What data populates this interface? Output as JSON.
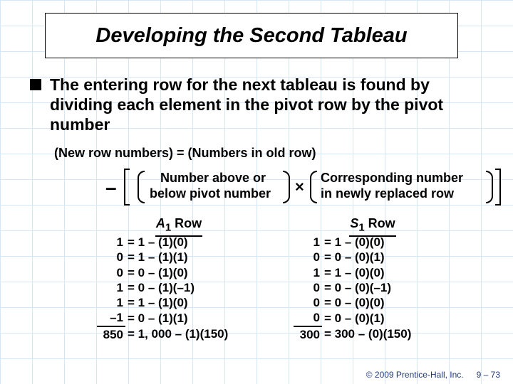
{
  "title": "Developing the Second Tableau",
  "bullet": "The entering row for the next tableau is found by dividing each element in the pivot row by the pivot number",
  "formula_line": "(New row numbers) = (Numbers in old row)",
  "minus": "–",
  "times": "×",
  "fragA_line1": "Number above or",
  "fragA_line2": "below pivot number",
  "fragB_line1": "Corresponding number",
  "fragB_line2": "in newly replaced row",
  "col_A": {
    "var": "A",
    "sub": "1",
    "tail": " Row"
  },
  "col_S": {
    "var": "S",
    "sub": "1",
    "tail": " Row"
  },
  "rowsA": [
    {
      "l": "1",
      "r": "= 1 – (1)(0)"
    },
    {
      "l": "0",
      "r": "= 1 – (1)(1)"
    },
    {
      "l": "0",
      "r": "= 0 – (1)(0)"
    },
    {
      "l": "1",
      "r": "= 0 – (1)(–1)"
    },
    {
      "l": "1",
      "r": "= 1 – (1)(0)"
    },
    {
      "l": "–1",
      "r": "= 0 – (1)(1)"
    },
    {
      "l": "850",
      "r": "= 1, 000 – (1)(150)"
    }
  ],
  "rowsS": [
    {
      "l": "1",
      "r": "= 1 – (0)(0)"
    },
    {
      "l": "0",
      "r": "= 0 – (0)(1)"
    },
    {
      "l": "1",
      "r": "= 1 – (0)(0)"
    },
    {
      "l": "0",
      "r": "= 0 – (0)(–1)"
    },
    {
      "l": "0",
      "r": "= 0 – (0)(0)"
    },
    {
      "l": "0",
      "r": "= 0 – (0)(1)"
    },
    {
      "l": "300",
      "r": "= 300 – (0)(150)"
    }
  ],
  "copyright": "© 2009 Prentice-Hall, Inc.",
  "pagenum": "9 – 73"
}
